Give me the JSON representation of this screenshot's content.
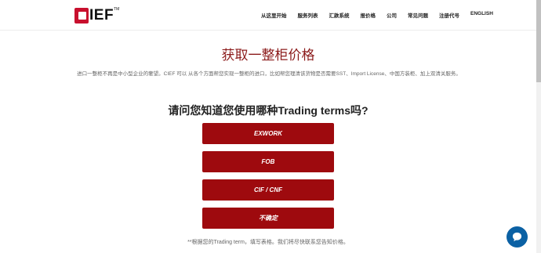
{
  "header": {
    "logo_text": "IEF",
    "logo_tm": "TM",
    "nav": [
      "从这里开始",
      "服务列表",
      "汇款系统",
      "报价格",
      "公司",
      "常见问题",
      "注册代号",
      "ENGLISH"
    ]
  },
  "main": {
    "title": "获取一整柜价格",
    "description": "进口一整柜不再是中小型企业的奢望。CIEF 可以 从各个方面帮您实现一整柜的进口，比如帮您理清该货物是否需要SST、Import License、中国方装柜、加上双清关服务。",
    "question": "请问您知道您使用哪种Trading terms吗?",
    "options": [
      "EXWORK",
      "FOB",
      "CIF / CNF",
      "不确定"
    ],
    "footnote": "**根据您的Trading term，填写表格。我们将尽快联系您告知价格。"
  },
  "colors": {
    "accent": "#9e0a0e",
    "title": "#8b1a1a",
    "chat": "#0b61a4"
  },
  "icons": {
    "chat": "chat-bubble-icon"
  }
}
